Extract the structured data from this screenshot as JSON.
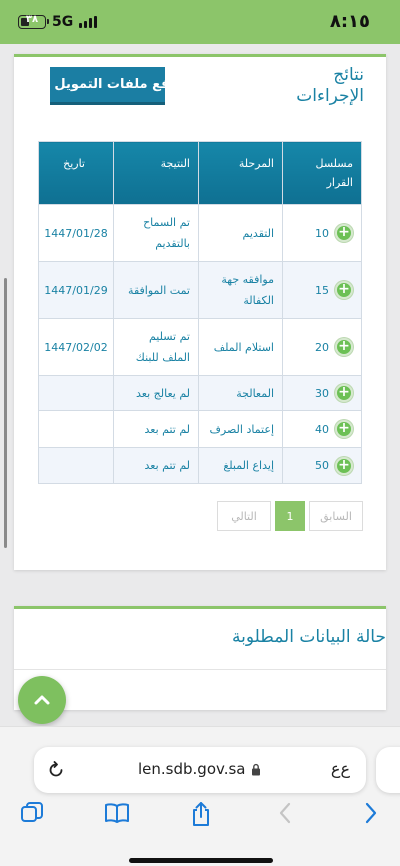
{
  "status_bar": {
    "time": "٨:١٥",
    "network": "5G",
    "battery_level": "٣٨",
    "battery_percent": 38
  },
  "results_card": {
    "title": "نتائج الإجراءات",
    "upload_button_label": "رفع ملفات التمويل",
    "table": {
      "headers": {
        "seq": "مسلسل القرار",
        "stage": "المرحلة",
        "result": "النتيجة",
        "date": "تاريخ"
      },
      "rows": [
        {
          "seq": "10",
          "stage": "التقديم",
          "result": "تم السماح بالتقديم",
          "date": "1447/01/28"
        },
        {
          "seq": "15",
          "stage": "موافقه جهة الكفالة",
          "result": "تمت الموافقة",
          "date": "1447/01/29"
        },
        {
          "seq": "20",
          "stage": "استلام الملف",
          "result": "تم تسليم الملف للبنك",
          "date": "1447/02/02"
        },
        {
          "seq": "30",
          "stage": "المعالجة",
          "result": "لم يعالج بعد",
          "date": ""
        },
        {
          "seq": "40",
          "stage": "إعتماد الصرف",
          "result": "لم تتم بعد",
          "date": ""
        },
        {
          "seq": "50",
          "stage": "إيداع المبلغ",
          "result": "لم تتم بعد",
          "date": ""
        }
      ]
    },
    "pagination": {
      "next": "التالي",
      "current": "1",
      "prev": "السابق"
    }
  },
  "status_card": {
    "title": "حالة البيانات المطلوبة"
  },
  "browser": {
    "url": "len.sdb.gov.sa",
    "text_size_label": "ﻉﻉ"
  },
  "icons": {
    "expand": "plus-circle-icon",
    "scroll_top": "chevron-up-icon",
    "reload": "reload-icon",
    "lock": "lock-icon",
    "tabs": "tabs-icon",
    "bookmarks": "book-icon",
    "share": "share-icon",
    "back": "chevron-left-icon",
    "forward": "chevron-right-icon"
  },
  "colors": {
    "accent_green": "#8cc56a",
    "header_blue": "#1687a9",
    "text_blue": "#1a82a4"
  }
}
